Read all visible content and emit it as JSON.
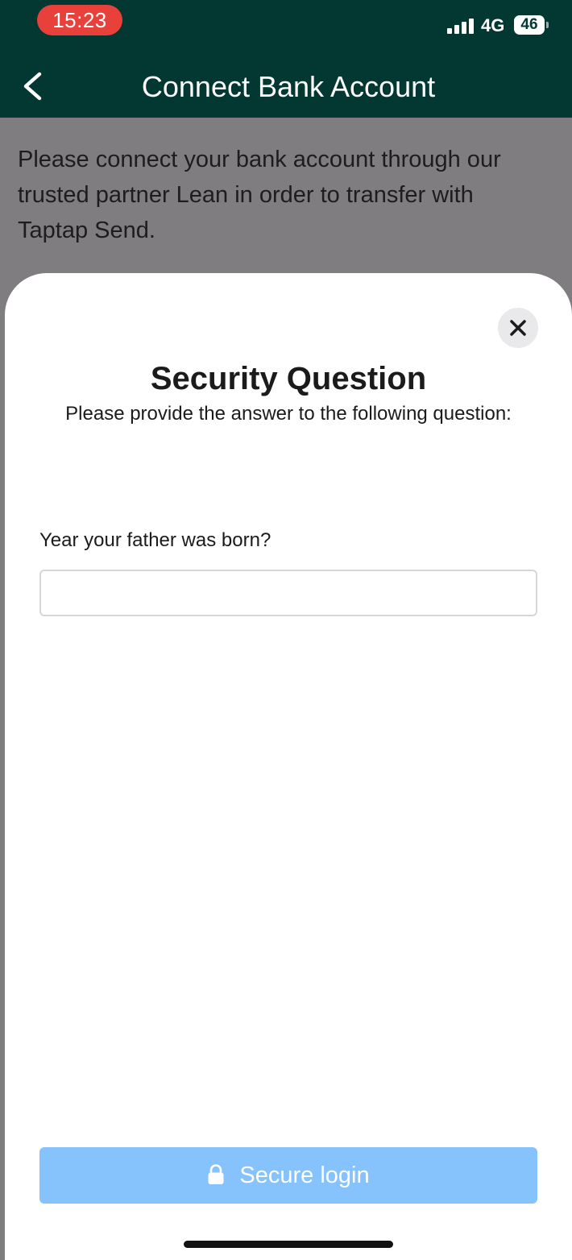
{
  "status_bar": {
    "time": "15:23",
    "network": "4G",
    "battery": "46",
    "icons": [
      "signal-icon",
      "battery-icon"
    ]
  },
  "nav": {
    "title": "Connect Bank Account",
    "back_icon": "chevron-left-icon"
  },
  "intro": {
    "text": "Please connect your bank account through our trusted partner Lean in order to transfer with Taptap Send."
  },
  "sheet": {
    "close_icon": "close-icon",
    "title": "Security Question",
    "subtitle": "Please provide the answer to the following question:",
    "question": "Year your father was born?",
    "answer_value": "",
    "answer_placeholder": "",
    "submit_label": "Secure login",
    "submit_icon": "lock-icon"
  },
  "colors": {
    "header_bg": "#033731",
    "time_pill": "#e8403a",
    "overlay": "#7f7d80",
    "button_disabled": "#86c2fb"
  }
}
